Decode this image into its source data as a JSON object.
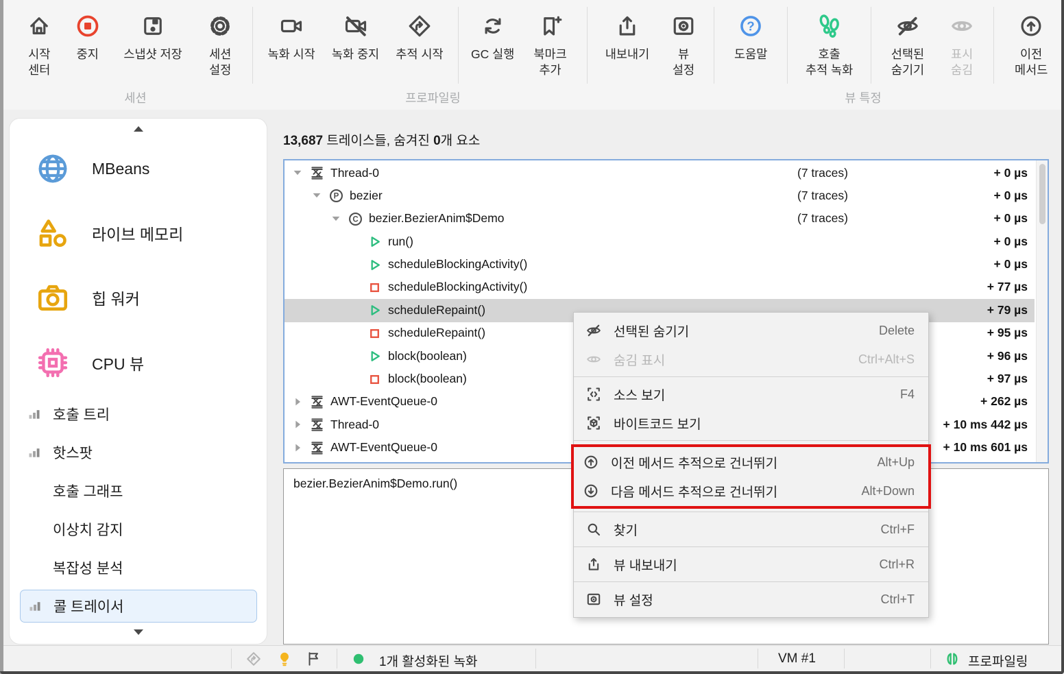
{
  "toolbar": {
    "buttons": {
      "start_center": "시작\n센터",
      "stop": "중지",
      "save_snapshot": "스냅샷 저장",
      "session_settings": "세션\n설정",
      "start_recordings": "녹화 시작",
      "stop_recordings": "녹화 중지",
      "start_tracking": "추적 시작",
      "run_gc": "GC 실행",
      "add_bookmark": "북마크\n추가",
      "export": "내보내기",
      "view_settings": "뷰\n설정",
      "help": "도움말",
      "record_call_tracing": "호출\n추적 녹화",
      "hide_selected": "선택된\n숨기기",
      "show_hidden": "표시\n숨김",
      "previous_method": "이전\n메서드"
    },
    "group_labels": {
      "session": "세션",
      "profiling": "프로파일링",
      "view_specific": "뷰 특정"
    }
  },
  "sidebar": {
    "items_large": [
      {
        "label": "MBeans"
      },
      {
        "label": "라이브 메모리"
      },
      {
        "label": "힙 워커"
      },
      {
        "label": "CPU 뷰"
      }
    ],
    "items_small": [
      {
        "label": "호출 트리"
      },
      {
        "label": "핫스팟"
      },
      {
        "label": "호출 그래프"
      },
      {
        "label": "이상치 감지"
      },
      {
        "label": "복잡성 분석"
      },
      {
        "label": "콜 트레이서"
      }
    ],
    "selected_item": "콜 트레이서"
  },
  "header": {
    "count": "13,687",
    "traces_text": " 트레이스들, 숨겨진 ",
    "hidden_count": "0",
    "hidden_text": "개 요소"
  },
  "tree": {
    "rows": [
      {
        "name": "Thread-0",
        "traces": "(7 traces)",
        "time": "+ 0 µs"
      },
      {
        "name": "bezier",
        "traces": "(7 traces)",
        "time": "+ 0 µs"
      },
      {
        "name": "bezier.BezierAnim$Demo",
        "traces": "(7 traces)",
        "time": "+ 0 µs"
      },
      {
        "name": "run()",
        "traces": "",
        "time": "+ 0 µs"
      },
      {
        "name": "scheduleBlockingActivity()",
        "traces": "",
        "time": "+ 0 µs"
      },
      {
        "name": "scheduleBlockingActivity()",
        "traces": "",
        "time": "+ 77 µs"
      },
      {
        "name": "scheduleRepaint()",
        "traces": "",
        "time": "+ 79 µs"
      },
      {
        "name": "scheduleRepaint()",
        "traces": "",
        "time": "+ 95 µs"
      },
      {
        "name": "block(boolean)",
        "traces": "",
        "time": "+ 96 µs"
      },
      {
        "name": "block(boolean)",
        "traces": "",
        "time": "+ 97 µs"
      },
      {
        "name": "AWT-EventQueue-0",
        "traces": "",
        "time": "+ 262 µs"
      },
      {
        "name": "Thread-0",
        "traces": "",
        "time": "+ 10 ms 442 µs"
      },
      {
        "name": "AWT-EventQueue-0",
        "traces": "",
        "time": "+ 10 ms 601 µs"
      }
    ]
  },
  "detail": {
    "text": "bezier.BezierAnim$Demo.run()"
  },
  "context_menu": {
    "items": [
      {
        "label": "선택된 숨기기",
        "shortcut": "Delete"
      },
      {
        "label": "숨김 표시",
        "shortcut": "Ctrl+Alt+S"
      },
      {
        "label": "소스 보기",
        "shortcut": "F4"
      },
      {
        "label": "바이트코드 보기",
        "shortcut": ""
      },
      {
        "label": "이전 메서드 추적으로 건너뛰기",
        "shortcut": "Alt+Up"
      },
      {
        "label": "다음 메서드 추적으로 건너뛰기",
        "shortcut": "Alt+Down"
      },
      {
        "label": "찾기",
        "shortcut": "Ctrl+F"
      },
      {
        "label": "뷰 내보내기",
        "shortcut": "Ctrl+R"
      },
      {
        "label": "뷰 설정",
        "shortcut": "Ctrl+T"
      }
    ]
  },
  "status_bar": {
    "recording": "1개 활성화된 녹화",
    "vm": "VM #1",
    "mode": "프로파일링"
  },
  "colors": {
    "accent_green": "#2ec98a",
    "accent_red": "#e8432d",
    "accent_blue": "#4f94e8",
    "accent_amber": "#e7a50f",
    "accent_pink": "#f36fb0",
    "highlight_rect": "#e01212",
    "tree_focus_border": "#84abdd",
    "selected_row": "#d5d5d5",
    "sidebar_selection_bg": "#eaf3fd"
  }
}
